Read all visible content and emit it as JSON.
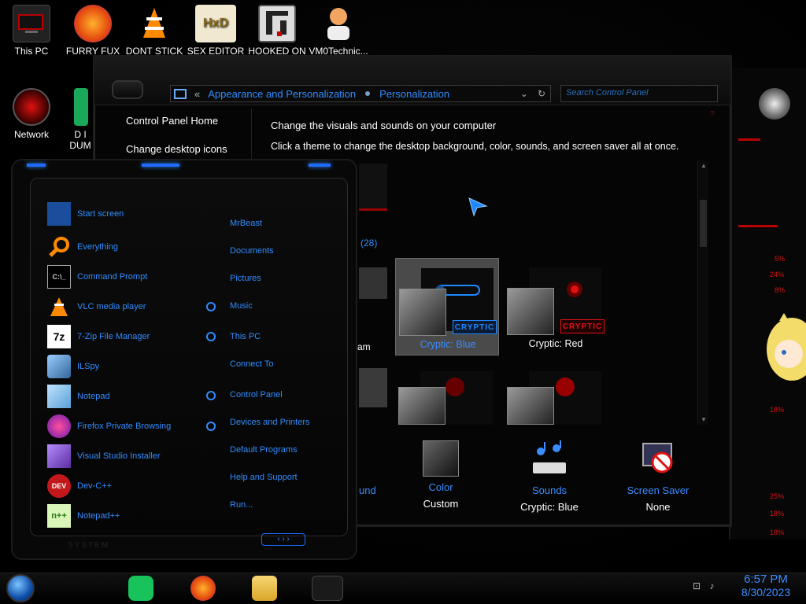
{
  "desktop": {
    "icons": [
      {
        "label": "This PC"
      },
      {
        "label": "FURRY FUX"
      },
      {
        "label": "DONT STICK"
      },
      {
        "label": "SEX EDITOR"
      },
      {
        "label": "HOOKED ON"
      },
      {
        "label": "VM0Technic..."
      },
      {
        "label": "Network"
      },
      {
        "label": "D I DUM"
      }
    ]
  },
  "control_panel": {
    "breadcrumb": [
      "Appearance and Personalization",
      "Personalization"
    ],
    "search_placeholder": "Search Control Panel",
    "left_links": [
      "Control Panel Home",
      "Change desktop icons"
    ],
    "heading": "Change the visuals and sounds on your computer",
    "subheading": "Click a theme to change the desktop background, color, sounds, and screen saver all at once.",
    "installed_count": "(28)",
    "partial_theme_label": "am",
    "themes": [
      {
        "name": "Cryptic: Blue",
        "badge": "CRYPTIC",
        "selected": true,
        "accent": "#1e88ff"
      },
      {
        "name": "Cryptic: Red",
        "badge": "CRYPTIC",
        "selected": false,
        "accent": "#e01010"
      }
    ],
    "bottom": {
      "partial_background_label": "und",
      "color": {
        "title": "Color",
        "value": "Custom"
      },
      "sounds": {
        "title": "Sounds",
        "value": "Cryptic: Blue"
      },
      "screensaver": {
        "title": "Screen Saver",
        "value": "None"
      }
    }
  },
  "start_menu": {
    "apps": [
      {
        "label": "Start screen",
        "icon": "start-screen-icon"
      },
      {
        "label": "Everything",
        "icon": "search-magnifier-icon"
      },
      {
        "label": "Command Prompt",
        "icon": "command-prompt-icon"
      },
      {
        "label": "VLC media player",
        "icon": "vlc-cone-icon"
      },
      {
        "label": "7-Zip File Manager",
        "icon": "7zip-icon"
      },
      {
        "label": "ILSpy",
        "icon": "ilspy-icon"
      },
      {
        "label": "Notepad",
        "icon": "notepad-icon"
      },
      {
        "label": "Firefox Private Browsing",
        "icon": "firefox-private-icon"
      },
      {
        "label": "Visual Studio Installer",
        "icon": "visual-studio-icon"
      },
      {
        "label": "Dev-C++",
        "icon": "devcpp-icon"
      },
      {
        "label": "Notepad++",
        "icon": "notepadpp-icon"
      }
    ],
    "places": [
      {
        "label": "MrBeast",
        "pin": false
      },
      {
        "label": "Documents",
        "pin": false
      },
      {
        "label": "Pictures",
        "pin": false
      },
      {
        "label": "Music",
        "pin": true
      },
      {
        "label": "This PC",
        "pin": true
      },
      {
        "label": "Connect To",
        "pin": false
      },
      {
        "label": "Control Panel",
        "pin": true
      },
      {
        "label": "Devices and Printers",
        "pin": true
      },
      {
        "label": "Default Programs",
        "pin": false
      },
      {
        "label": "Help and Support",
        "pin": false
      },
      {
        "label": "Run...",
        "pin": false
      }
    ],
    "footer_label": "SYSTEM"
  },
  "right_panel": {
    "texts": [
      "5%",
      "24%",
      "8%",
      "18%",
      "25%",
      "18%",
      "18%"
    ]
  },
  "taskbar": {
    "time": "6:57 PM",
    "date": "8/30/2023"
  },
  "colors": {
    "accent_blue": "#2f8cff",
    "accent_red": "#e01010"
  }
}
